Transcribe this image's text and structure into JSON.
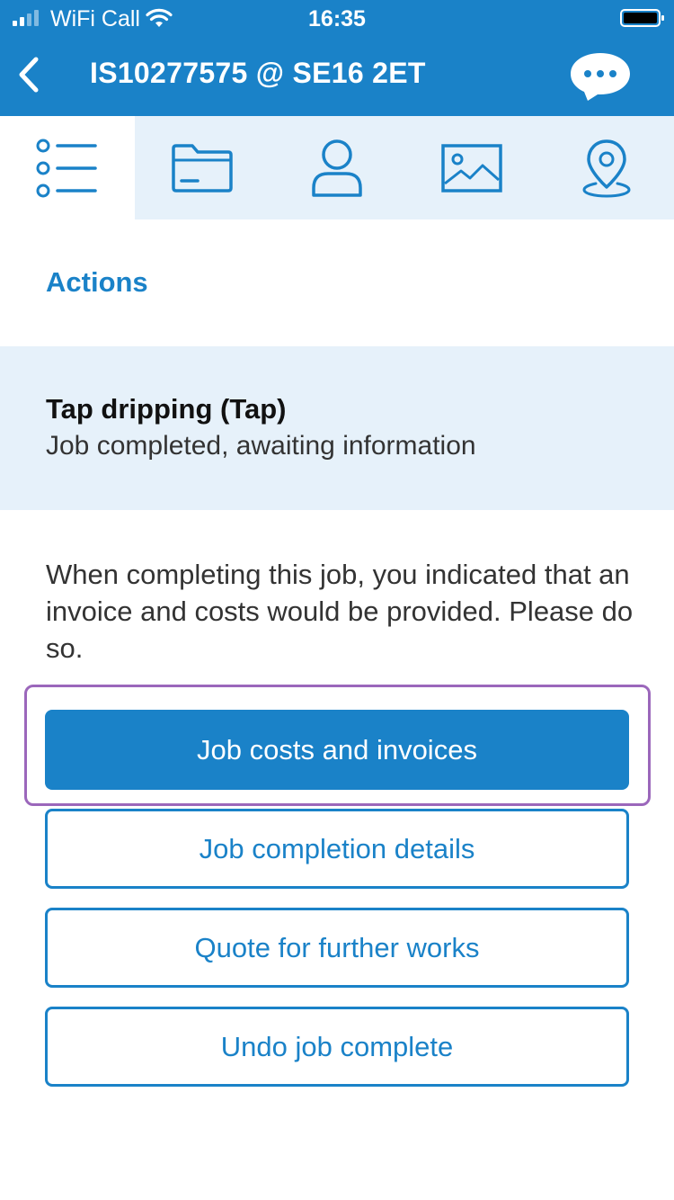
{
  "status_bar": {
    "carrier": "WiFi Call",
    "time": "16:35"
  },
  "nav": {
    "title": "IS10277575 @ SE16 2ET"
  },
  "tabs": [
    {
      "icon": "list-icon",
      "active": true
    },
    {
      "icon": "folder-icon",
      "active": false
    },
    {
      "icon": "person-icon",
      "active": false
    },
    {
      "icon": "image-icon",
      "active": false
    },
    {
      "icon": "location-pin-icon",
      "active": false
    }
  ],
  "content": {
    "section_heading": "Actions",
    "job_title": "Tap dripping (Tap)",
    "job_status": "Job completed, awaiting information",
    "instruction": "When completing this job, you indicated that an invoice and costs would be provided. Please do so."
  },
  "actions": {
    "job_costs": "Job costs and invoices",
    "completion_details": "Job completion details",
    "quote_further": "Quote for further works",
    "undo_complete": "Undo job complete"
  },
  "colors": {
    "brand_blue": "#1a82c8",
    "tab_background": "#e6f1fa",
    "focus_ring": "#9b67bb"
  }
}
